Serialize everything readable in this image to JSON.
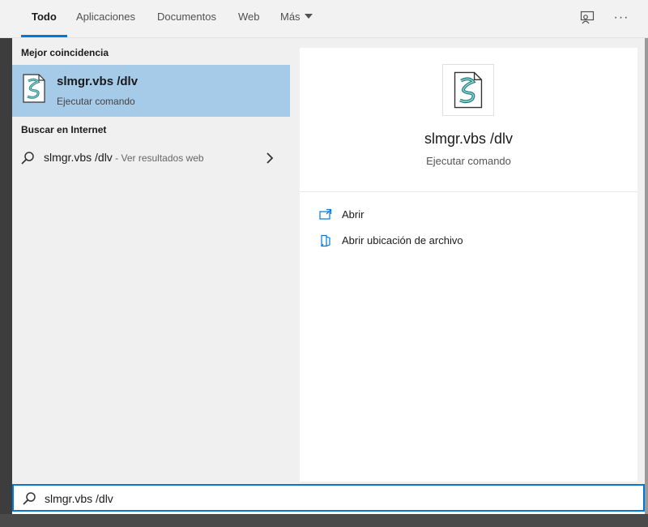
{
  "tabs": [
    {
      "label": "Todo",
      "active": true
    },
    {
      "label": "Aplicaciones",
      "active": false
    },
    {
      "label": "Documentos",
      "active": false
    },
    {
      "label": "Web",
      "active": false
    },
    {
      "label": "Más",
      "active": false
    }
  ],
  "top_icons": [
    "feedback-icon",
    "more-options-icon"
  ],
  "more_label": "···",
  "best_match": {
    "section_title": "Mejor coincidencia",
    "title": "slmgr.vbs /dlv",
    "subtitle": "Ejecutar comando",
    "icon": "vbs-script-icon"
  },
  "web_search": {
    "section_title": "Buscar en Internet",
    "query": "slmgr.vbs /dlv",
    "separator": " - ",
    "suffix": "Ver resultados web"
  },
  "preview": {
    "title": "slmgr.vbs /dlv",
    "subtitle": "Ejecutar comando",
    "actions": [
      {
        "label": "Abrir",
        "icon": "open-icon"
      },
      {
        "label": "Abrir ubicación de archivo",
        "icon": "file-location-icon"
      }
    ]
  },
  "search_box": {
    "value": "slmgr.vbs /dlv"
  },
  "colors": {
    "accent": "#0078d7",
    "selected_row": "#a6cbe9"
  }
}
